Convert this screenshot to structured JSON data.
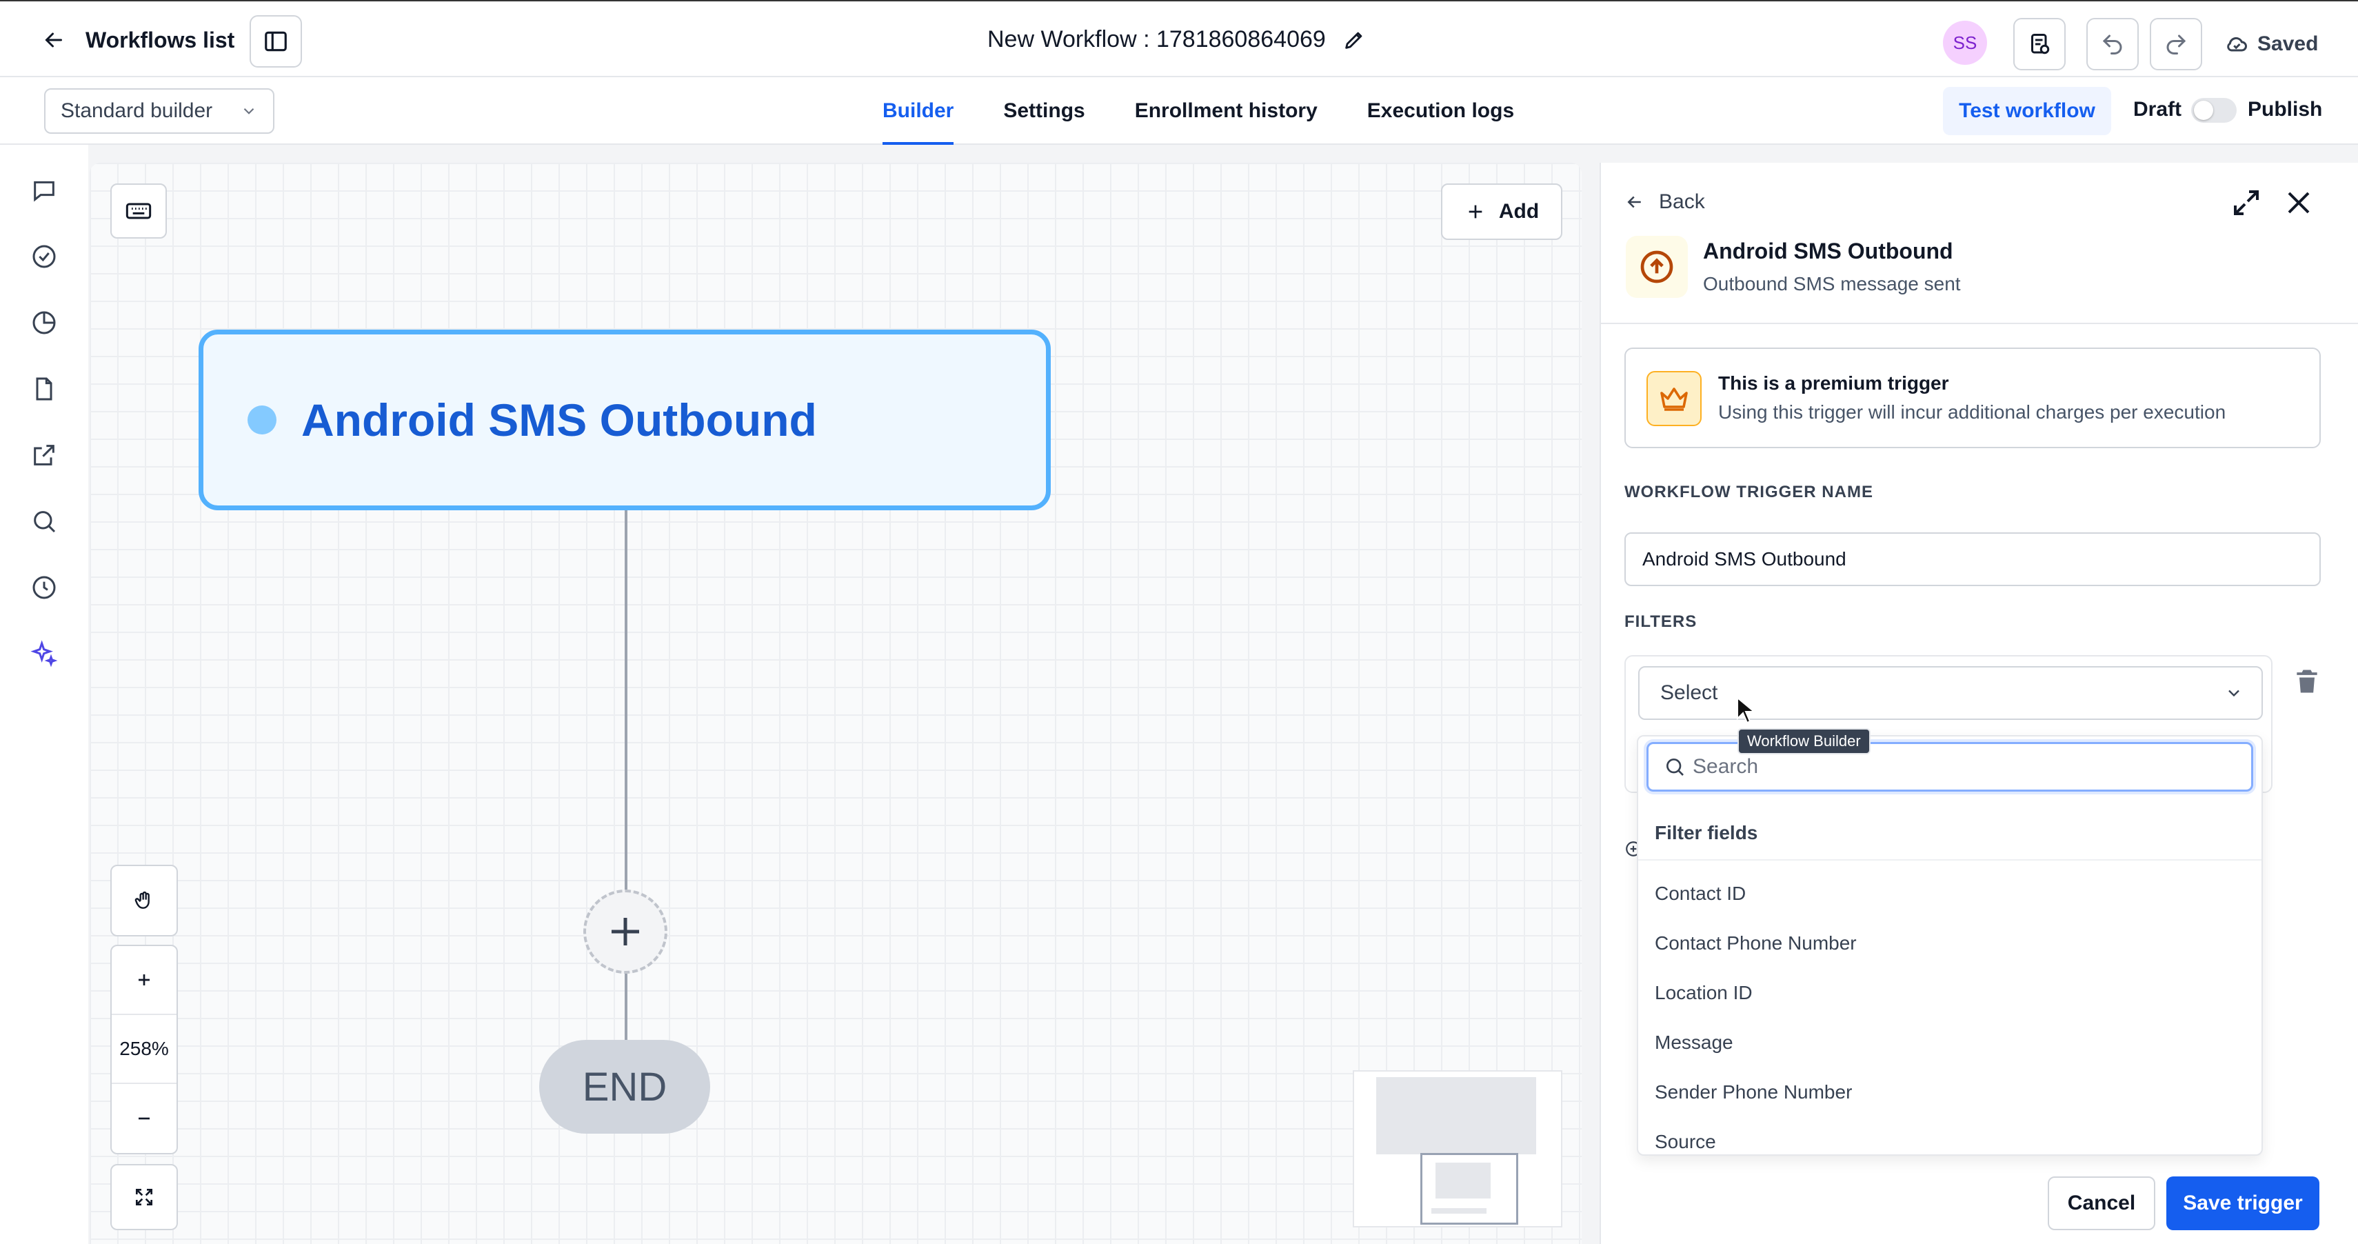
{
  "header": {
    "back_label": "Workflows list",
    "workflow_title": "New Workflow : 1781860864069",
    "avatar_initials": "SS",
    "saved_label": "Saved"
  },
  "subbar": {
    "builder_select": "Standard builder",
    "tabs": [
      {
        "label": "Builder",
        "active": true
      },
      {
        "label": "Settings",
        "active": false
      },
      {
        "label": "Enrollment history",
        "active": false
      },
      {
        "label": "Execution logs",
        "active": false
      }
    ],
    "test_label": "Test workflow",
    "draft_label": "Draft",
    "publish_label": "Publish",
    "publish_enabled": false
  },
  "rail": {
    "icons": [
      "chat-icon",
      "check-circle-icon",
      "pie-chart-icon",
      "document-icon",
      "external-link-icon",
      "search-icon",
      "clock-icon",
      "sparkle-icon"
    ]
  },
  "canvas": {
    "add_label": "Add",
    "trigger_label": "Android SMS Outbound",
    "end_label": "END",
    "zoom": "258%"
  },
  "panel": {
    "back_label": "Back",
    "title": "Android SMS Outbound",
    "subtitle": "Outbound SMS message sent",
    "premium_title": "This is a premium trigger",
    "premium_body": "Using this trigger will incur additional charges per execution",
    "trigger_name_label": "WORKFLOW TRIGGER NAME",
    "trigger_name_value": "Android SMS Outbound",
    "filters_label": "FILTERS",
    "filter_select_value": "Select",
    "search_placeholder": "Search",
    "dropdown_header": "Filter fields",
    "dropdown_items": [
      "Contact ID",
      "Contact Phone Number",
      "Location ID",
      "Message",
      "Sender Phone Number",
      "Source"
    ],
    "tooltip": "Workflow Builder",
    "cancel_label": "Cancel",
    "save_label": "Save trigger"
  },
  "colors": {
    "accent": "#155eef",
    "trigger_border": "#53b1fd",
    "trigger_text": "#175cd3",
    "premium": "#fdb022"
  }
}
